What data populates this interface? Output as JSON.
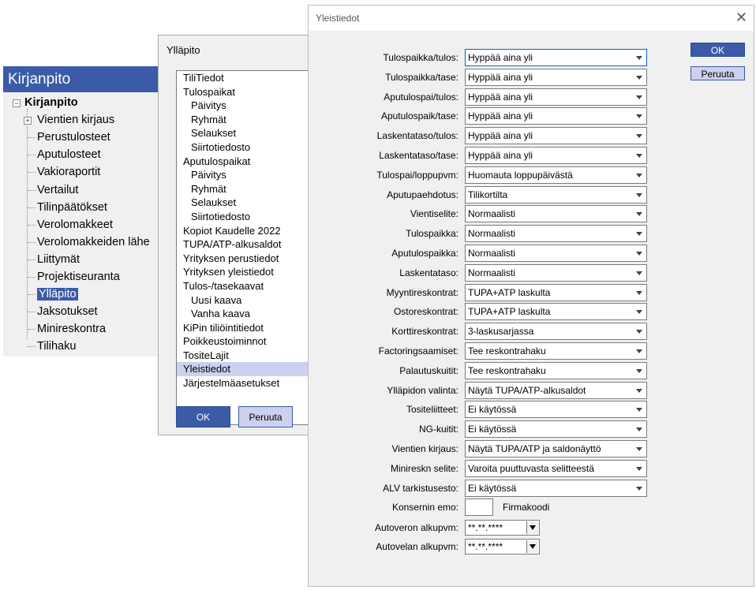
{
  "tree": {
    "title": "Kirjanpito",
    "root": "Kirjanpito",
    "items": [
      "Vientien kirjaus",
      "Perustulosteet",
      "Aputulosteet",
      "Vakioraportit",
      "Vertailut",
      "Tilinpäätökset",
      "Verolomakkeet",
      "Verolomakkeiden lähe",
      "Liittymät",
      "Projektiseuranta",
      "Ylläpito",
      "Jaksotukset",
      "Minireskontra",
      "Tilihaku"
    ],
    "selected": "Ylläpito"
  },
  "yllapito": {
    "title": "Ylläpito",
    "items": [
      {
        "label": "TiliTiedot",
        "sub": false
      },
      {
        "label": "Tulospaikat",
        "sub": false
      },
      {
        "label": "Päivitys",
        "sub": true
      },
      {
        "label": "Ryhmät",
        "sub": true
      },
      {
        "label": "Selaukset",
        "sub": true
      },
      {
        "label": "Siirtotiedosto",
        "sub": true
      },
      {
        "label": "Aputulospaikat",
        "sub": false
      },
      {
        "label": "Päivitys",
        "sub": true
      },
      {
        "label": "Ryhmät",
        "sub": true
      },
      {
        "label": "Selaukset",
        "sub": true
      },
      {
        "label": "Siirtotiedosto",
        "sub": true
      },
      {
        "label": "Kopiot Kaudelle 2022",
        "sub": false
      },
      {
        "label": "TUPA/ATP-alkusaldot",
        "sub": false
      },
      {
        "label": "Yrityksen perustiedot",
        "sub": false
      },
      {
        "label": "Yrityksen yleistiedot",
        "sub": false
      },
      {
        "label": "Tulos-/tasekaavat",
        "sub": false
      },
      {
        "label": "Uusi kaava",
        "sub": true
      },
      {
        "label": "Vanha kaava",
        "sub": true
      },
      {
        "label": "KiPin tiliöintitiedot",
        "sub": false
      },
      {
        "label": "Poikkeustoiminnot",
        "sub": false
      },
      {
        "label": "TositeLajit",
        "sub": false
      },
      {
        "label": "Yleistiedot",
        "sub": false,
        "selected": true
      },
      {
        "label": "Järjestelmäasetukset",
        "sub": false
      }
    ],
    "ok_label": "OK",
    "cancel_label": "Peruuta"
  },
  "yleistiedot": {
    "title": "Yleistiedot",
    "ok_label": "OK",
    "cancel_label": "Peruuta",
    "fields": [
      {
        "label": "Tulospaikka/tulos:",
        "value": "Hyppää aina yli"
      },
      {
        "label": "Tulospaikka/tase:",
        "value": "Hyppää aina yli"
      },
      {
        "label": "Aputulospai/tulos:",
        "value": "Hyppää aina yli"
      },
      {
        "label": "Aputulospaik/tase:",
        "value": "Hyppää aina yli"
      },
      {
        "label": "Laskentataso/tulos:",
        "value": "Hyppää aina yli"
      },
      {
        "label": "Laskentataso/tase:",
        "value": "Hyppää aina yli"
      },
      {
        "label": "Tulospai/loppupvm:",
        "value": "Huomauta loppupäivästä"
      },
      {
        "label": "Aputupaehdotus:",
        "value": "Tilikortilta"
      },
      {
        "label": "Vientiselite:",
        "value": "Normaalisti"
      },
      {
        "label": "Tulospaikka:",
        "value": "Normaalisti"
      },
      {
        "label": "Aputulospaikka:",
        "value": "Normaalisti"
      },
      {
        "label": "Laskentataso:",
        "value": "Normaalisti"
      },
      {
        "label": "Myyntireskontrat:",
        "value": "TUPA+ATP laskulta"
      },
      {
        "label": "Ostoreskontrat:",
        "value": "TUPA+ATP laskulta"
      },
      {
        "label": "Korttireskontrat:",
        "value": "3-laskusarjassa"
      },
      {
        "label": "Factoringsaamiset:",
        "value": "Tee reskontrahaku"
      },
      {
        "label": "Palautuskuitit:",
        "value": "Tee reskontrahaku"
      },
      {
        "label": "Ylläpidon valinta:",
        "value": "Näytä TUPA/ATP-alkusaldot"
      },
      {
        "label": "Tositeliitteet:",
        "value": "Ei käytössä"
      },
      {
        "label": "NG-kuitit:",
        "value": "Ei käytössä"
      },
      {
        "label": "Vientien kirjaus:",
        "value": "Näytä TUPA/ATP ja saldonäyttö"
      },
      {
        "label": "Minireskn selite:",
        "value": "Varoita puuttuvasta selitteestä"
      },
      {
        "label": "ALV tarkistusesto:",
        "value": "Ei käytössä"
      }
    ],
    "konserni": {
      "label": "Konsernin emo:",
      "value": "",
      "firmakoodi_label": "Firmakoodi"
    },
    "autovero": {
      "label": "Autoveron alkupvm:",
      "value": "**.**.****"
    },
    "autovelka": {
      "label": "Autovelan alkupvm:",
      "value": "**.**.****"
    }
  }
}
